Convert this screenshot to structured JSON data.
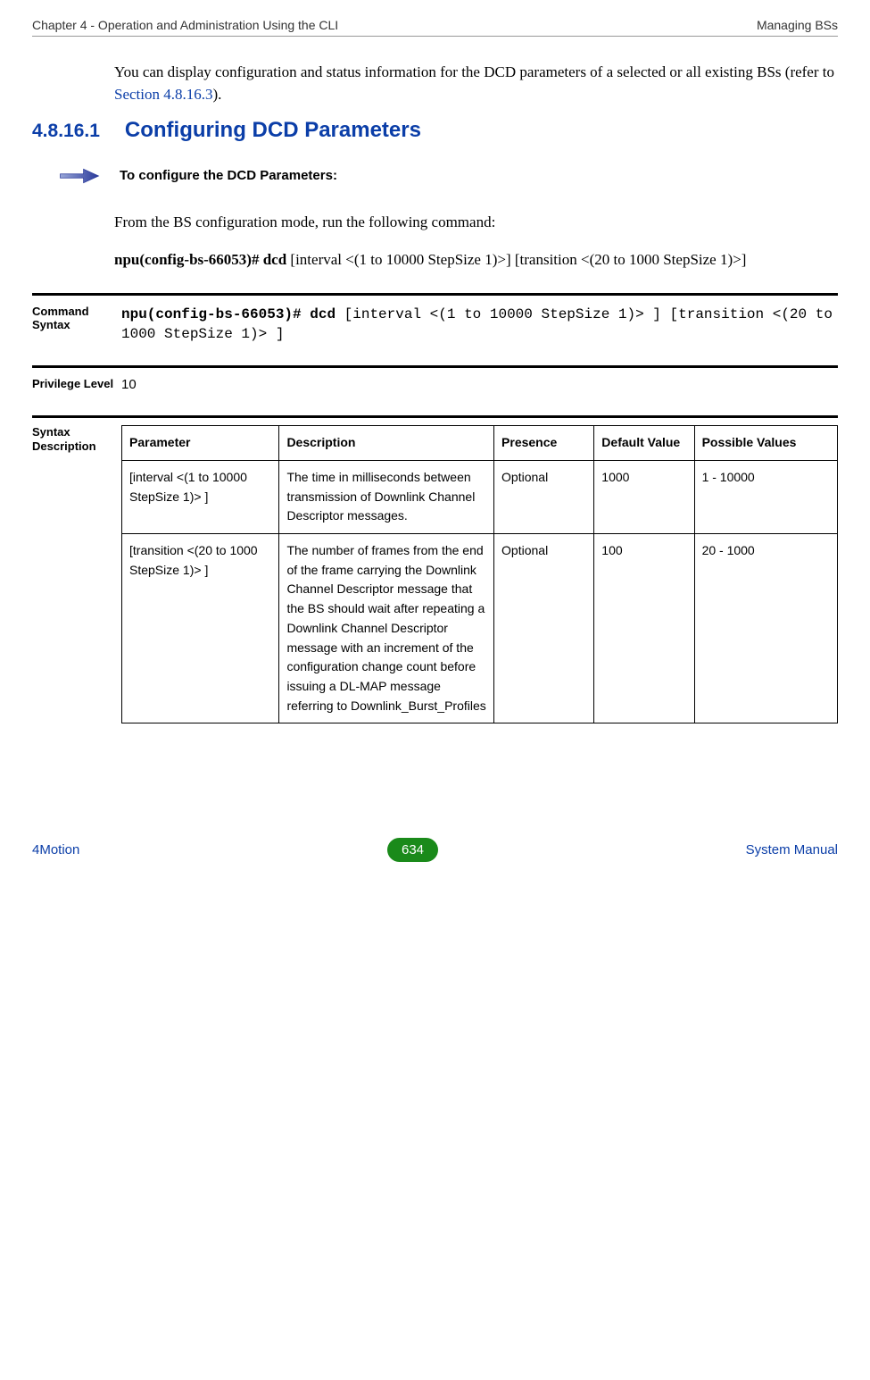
{
  "header": {
    "left": "Chapter 4 - Operation and Administration Using the CLI",
    "right": "Managing BSs"
  },
  "intro": {
    "pre": "You can display configuration and status information for the DCD parameters of a selected or all existing BSs (refer to ",
    "link": "Section 4.8.16.3",
    "post": ")."
  },
  "section": {
    "number": "4.8.16.1",
    "title": "Configuring DCD Parameters"
  },
  "procedure_title": "To configure the DCD Parameters:",
  "run_line": "From the BS configuration mode, run the following command:",
  "command_example": {
    "bold": "npu(config-bs-66053)# dcd",
    "rest": " [interval <(1 to 10000 StepSize 1)>] [transition <(20 to 1000 StepSize 1)>]"
  },
  "command_syntax": {
    "label": "Command Syntax",
    "bold": "npu(config-bs-66053)# dcd",
    "rest": " [interval <(1 to 10000 StepSize 1)> ] [transition <(20 to 1000 StepSize 1)> ]"
  },
  "privilege": {
    "label": "Privilege Level",
    "value": "10"
  },
  "syntax": {
    "label": "Syntax Description",
    "headers": [
      "Parameter",
      "Description",
      "Presence",
      "Default Value",
      "Possible Values"
    ],
    "rows": [
      {
        "param": "[interval <(1 to 10000 StepSize 1)> ]",
        "desc": "The time in milliseconds between transmission of Downlink Channel Descriptor messages.",
        "presence": "Optional",
        "default": "1000",
        "possible": "1 - 10000"
      },
      {
        "param": "[transition <(20 to 1000 StepSize 1)> ]",
        "desc": "The number of frames from the end of the frame carrying the Downlink Channel Descriptor message that the BS should wait after repeating a Downlink Channel Descriptor message with an increment  of the configuration change count before issuing a DL-MAP message referring to Downlink_Burst_Profiles",
        "presence": "Optional",
        "default": "100",
        "possible": "20 - 1000"
      }
    ]
  },
  "footer": {
    "left": "4Motion",
    "page": "634",
    "right": "System Manual"
  }
}
